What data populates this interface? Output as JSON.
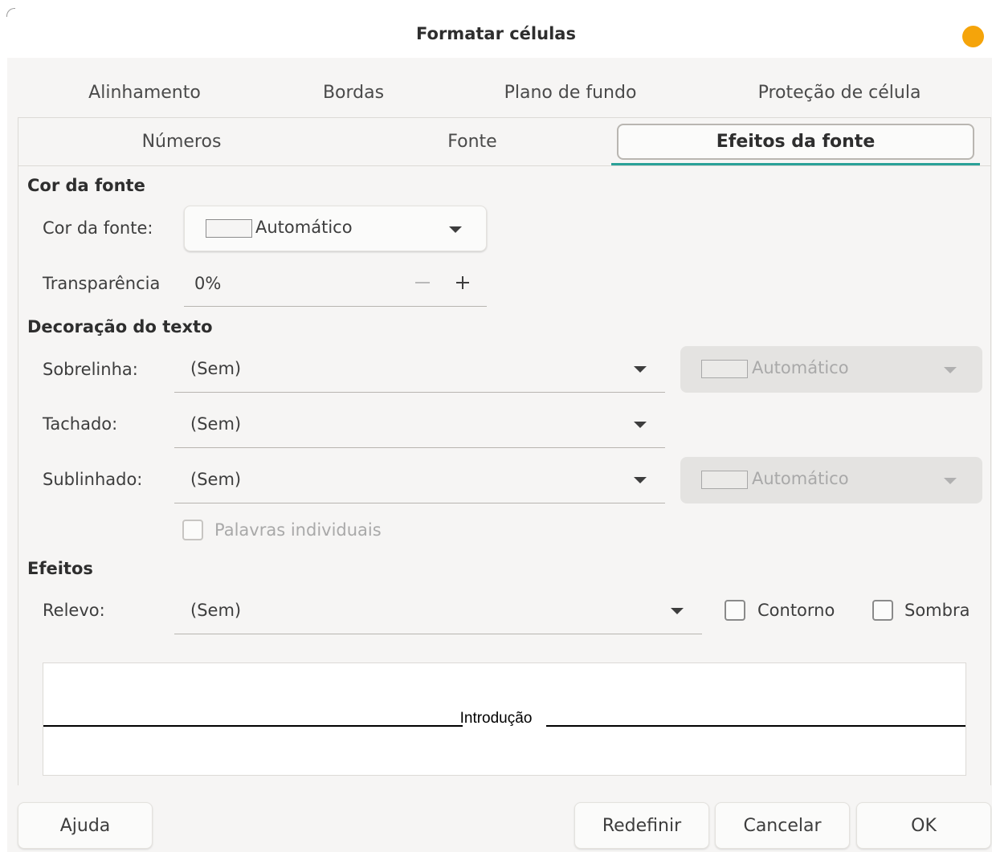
{
  "window": {
    "title": "Formatar células"
  },
  "tabs": {
    "row1": [
      "Alinhamento",
      "Bordas",
      "Plano de fundo",
      "Proteção de célula"
    ],
    "row2": [
      "Números",
      "Fonte",
      "Efeitos da fonte"
    ],
    "active": "Efeitos da fonte"
  },
  "font_color": {
    "section_title": "Cor da fonte",
    "color_label": "Cor da fonte:",
    "color_value": "Automático",
    "transparency_label": "Transparência",
    "transparency_value": "0%"
  },
  "text_decoration": {
    "section_title": "Decoração do texto",
    "overline_label": "Sobrelinha:",
    "overline_value": "(Sem)",
    "overline_color": "Automático",
    "strikethrough_label": "Tachado:",
    "strikethrough_value": "(Sem)",
    "underline_label": "Sublinhado:",
    "underline_value": "(Sem)",
    "underline_color": "Automático",
    "individual_words_label": "Palavras individuais"
  },
  "effects": {
    "section_title": "Efeitos",
    "relief_label": "Relevo:",
    "relief_value": "(Sem)",
    "outline_label": "Contorno",
    "shadow_label": "Sombra"
  },
  "preview": {
    "text": "Introdução"
  },
  "buttons": {
    "help": "Ajuda",
    "reset": "Redefinir",
    "cancel": "Cancelar",
    "ok": "OK"
  },
  "colors": {
    "accent": "#2aa198",
    "close_dot": "#f5a40a",
    "dialog_bg": "#f6f5f4"
  }
}
